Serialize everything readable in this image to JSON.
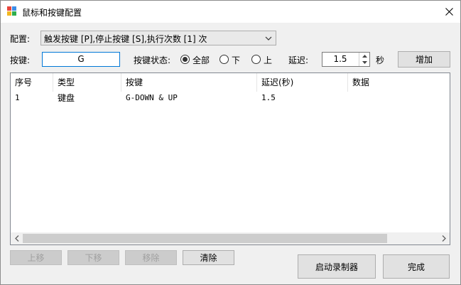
{
  "window": {
    "title": "鼠标和按键配置"
  },
  "config": {
    "label": "配置:",
    "selected": "触发按键 [P],停止按键 [S],执行次数 [1] 次"
  },
  "key": {
    "label": "按键:",
    "value": "G"
  },
  "key_state": {
    "label": "按键状态:",
    "options": [
      {
        "label": "全部",
        "checked": true
      },
      {
        "label": "下",
        "checked": false
      },
      {
        "label": "上",
        "checked": false
      }
    ]
  },
  "delay": {
    "label": "延迟:",
    "value": "1.5",
    "unit": "秒"
  },
  "add_button": "增加",
  "table": {
    "columns": [
      "序号",
      "类型",
      "按键",
      "延迟(秒)",
      "数据"
    ],
    "rows": [
      [
        "1",
        "键盘",
        "G-DOWN & UP",
        "1.5",
        ""
      ]
    ]
  },
  "buttons": {
    "move_up": "上移",
    "move_down": "下移",
    "remove": "移除",
    "clear": "清除",
    "start_recorder": "启动录制器",
    "done": "完成"
  }
}
